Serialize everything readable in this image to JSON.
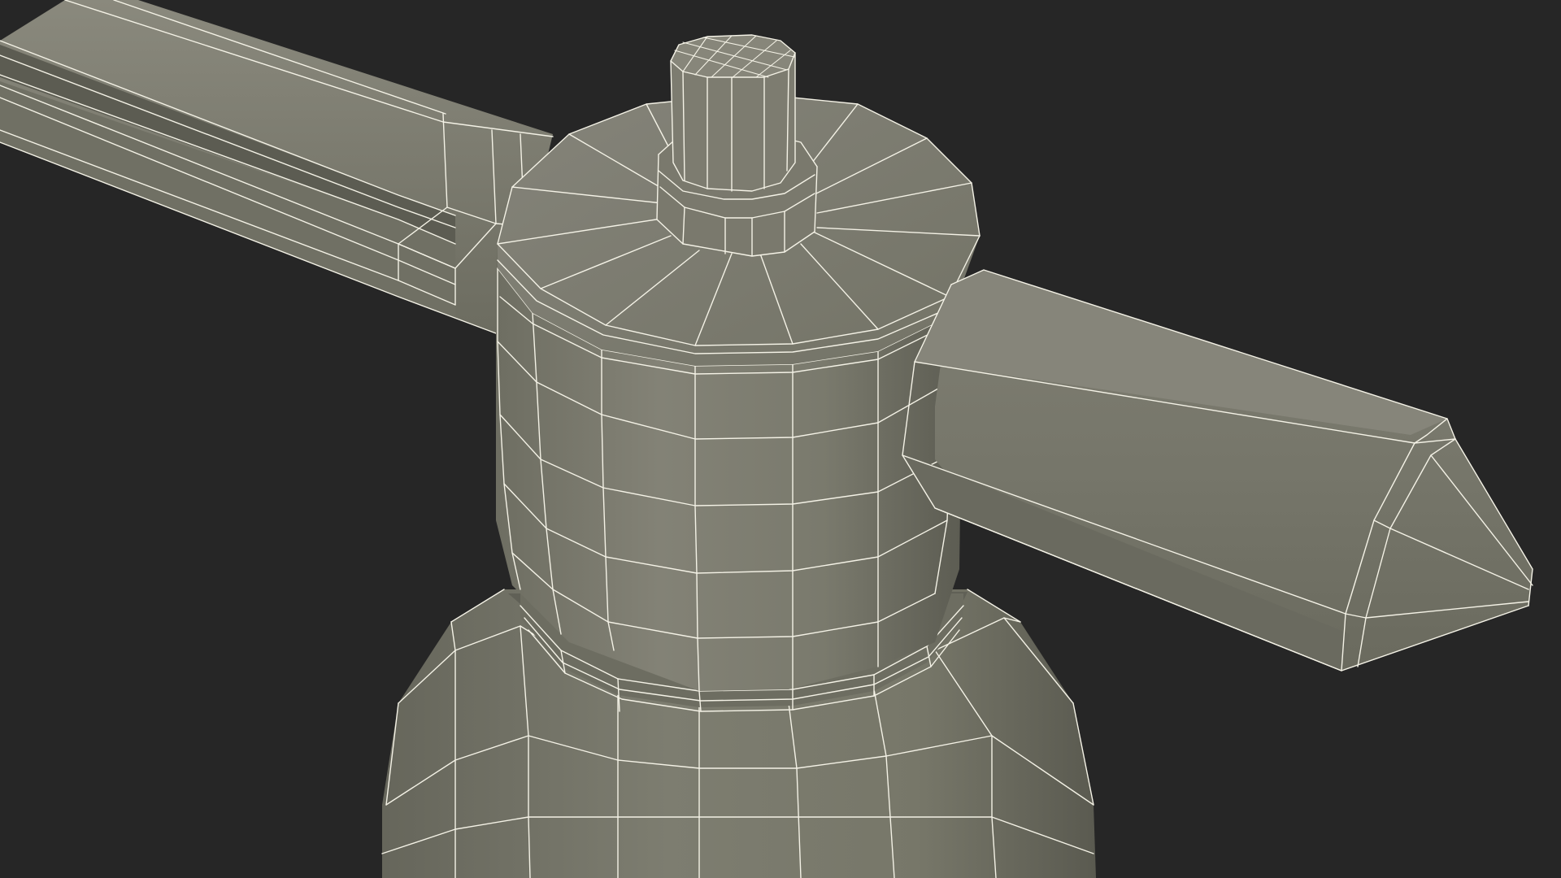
{
  "scene": {
    "subject": "wireframe-3d-model-sprayer-pump-head",
    "colors": {
      "background": "#262626",
      "surface_light": "#807f72",
      "surface_mid": "#767669",
      "surface_dark": "#5f5f54",
      "surface_shadow": "#4a4a42",
      "wireframe": "#f4f2e6"
    }
  }
}
